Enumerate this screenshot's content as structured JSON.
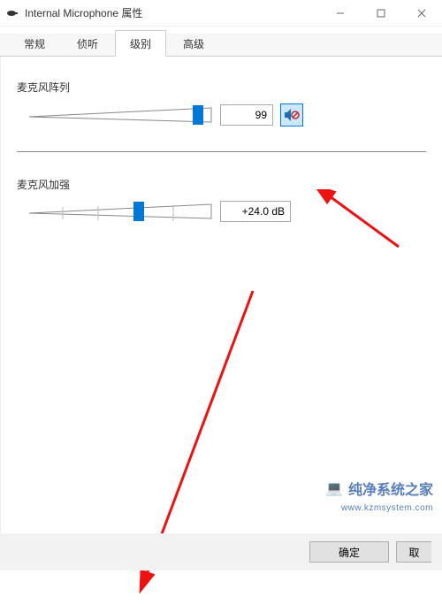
{
  "title": "Internal Microphone 属性",
  "tabs": {
    "general": "常规",
    "listen": "侦听",
    "levels": "级别",
    "advanced": "高级"
  },
  "mic_array": {
    "label": "麦克风阵列",
    "value": "99",
    "slider_pct": 92
  },
  "boost": {
    "label": "麦克风加强",
    "value": "+24.0 dB",
    "slider_pct": 60
  },
  "buttons": {
    "ok": "确定",
    "cancel_partial": "取"
  },
  "icons": {
    "mic": "mic-icon",
    "speaker_muted": "speaker-muted-icon"
  },
  "watermark": {
    "text": "纯净系统之家",
    "url": "www.kzmsystem.com"
  }
}
